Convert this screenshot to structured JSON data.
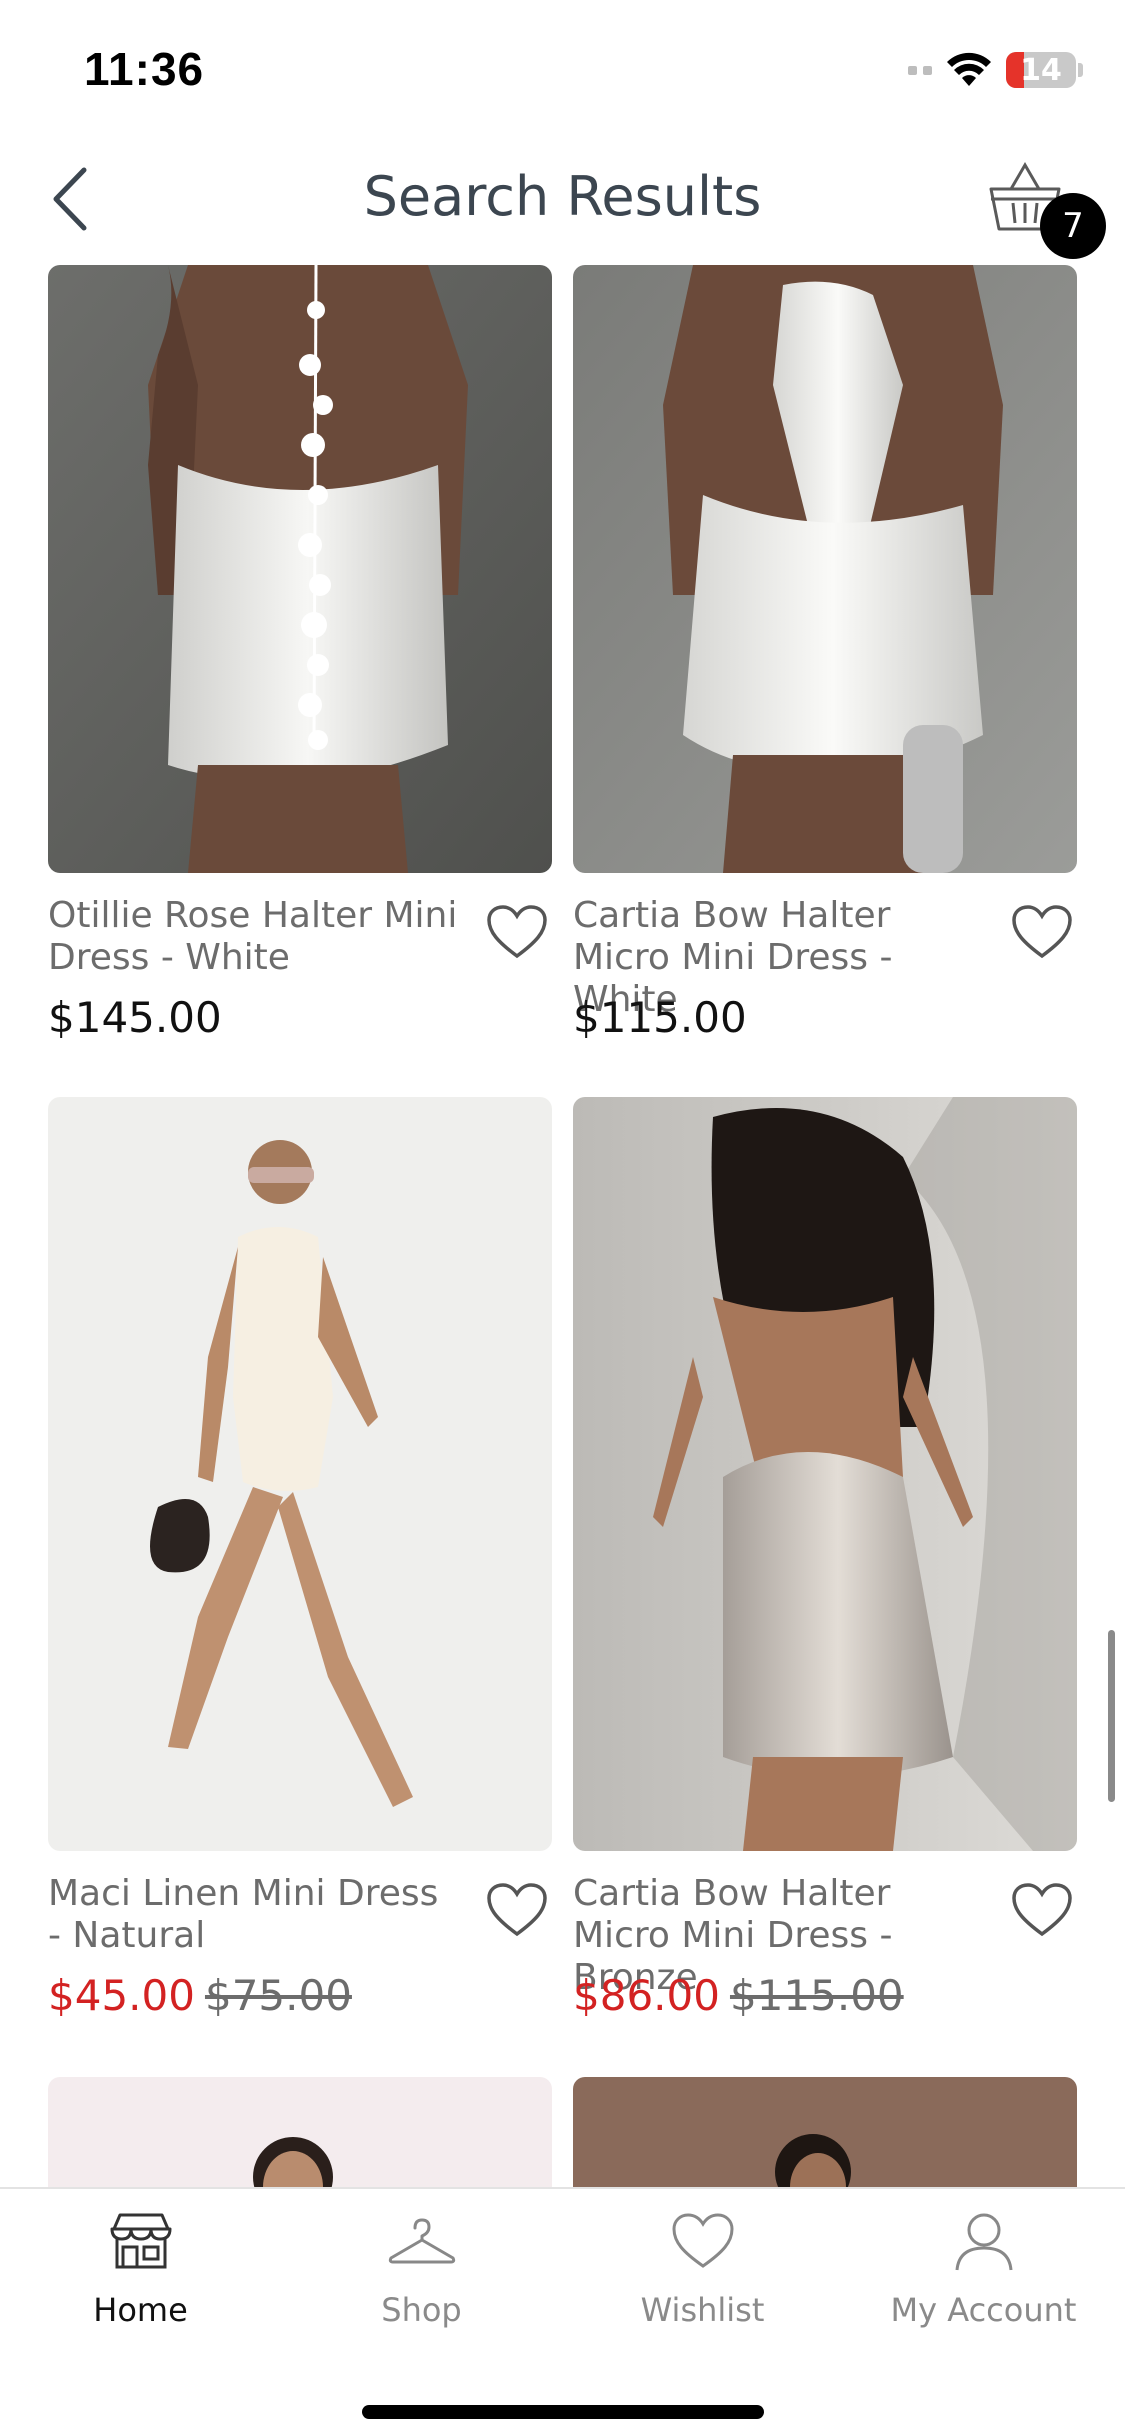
{
  "status_bar": {
    "time": "11:36",
    "battery": "14"
  },
  "header": {
    "title": "Search Results",
    "basket_count": "7"
  },
  "products": [
    {
      "name": "Otillie Rose Halter Mini Dress - White",
      "price": "$145.00",
      "sale_price": "",
      "original_price": ""
    },
    {
      "name": "Cartia Bow Halter Micro Mini Dress - White",
      "price": "$115.00",
      "sale_price": "",
      "original_price": ""
    },
    {
      "name": "Maci Linen Mini Dress - Natural",
      "price": "",
      "sale_price": "$45.00",
      "original_price": "$75.00"
    },
    {
      "name": "Cartia Bow Halter Micro Mini Dress - Bronze",
      "price": "",
      "sale_price": "$86.00",
      "original_price": "$115.00"
    }
  ],
  "tabs": [
    {
      "label": "Home",
      "icon": "storefront-icon",
      "active": true
    },
    {
      "label": "Shop",
      "icon": "hanger-icon",
      "active": false
    },
    {
      "label": "Wishlist",
      "icon": "heart-icon",
      "active": false
    },
    {
      "label": "My Account",
      "icon": "person-icon",
      "active": false
    }
  ],
  "colors": {
    "sale": "#d32222",
    "text_muted": "#6c6c6c",
    "title": "#3c4650"
  }
}
